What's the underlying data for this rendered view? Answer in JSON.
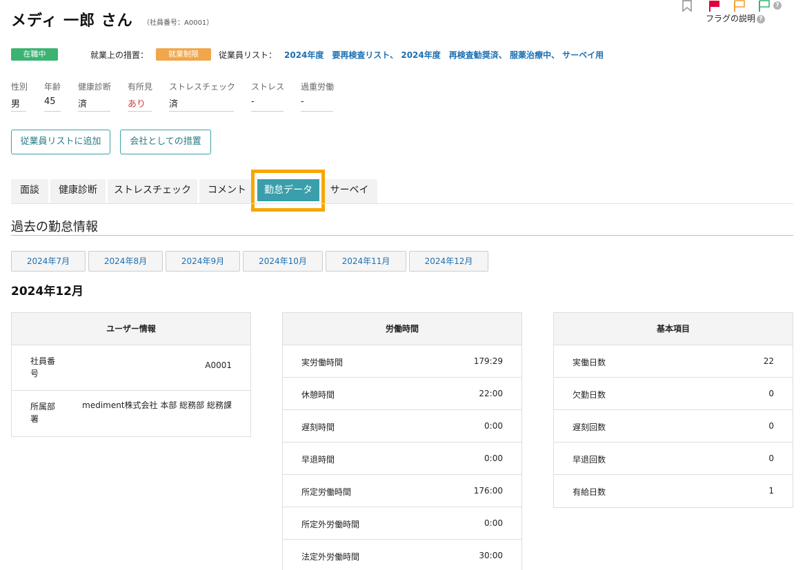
{
  "header": {
    "name": "メディ 一郎 さん",
    "employee_no": "（社員番号：A0001）",
    "flag_explain": "フラグの説明",
    "help_mark": "?"
  },
  "status": {
    "employment": "在職中",
    "measure_label": "就業上の措置：",
    "measure_value": "就業制限",
    "list_label": "従業員リスト：",
    "lists": [
      "2024年度　要再検査リスト、",
      "2024年度　再検査勧奨済、",
      "服薬治療中、",
      "サーベイ用"
    ]
  },
  "attributes": [
    {
      "label": "性別",
      "value": "男"
    },
    {
      "label": "年齢",
      "value": "45"
    },
    {
      "label": "健康診断",
      "value": "済"
    },
    {
      "label": "有所見",
      "value": "あり"
    },
    {
      "label": "ストレスチェック",
      "value": "済"
    },
    {
      "label": "ストレス",
      "value": "-"
    },
    {
      "label": "過重労働",
      "value": "-"
    }
  ],
  "actions": {
    "add_to_list": "従業員リストに追加",
    "company_measure": "会社としての措置"
  },
  "tabs": [
    "面談",
    "健康診断",
    "ストレスチェック",
    "コメント",
    "勤怠データ",
    "サーベイ"
  ],
  "section_title": "過去の勤怠情報",
  "months": [
    "2024年7月",
    "2024年8月",
    "2024年9月",
    "2024年10月",
    "2024年11月",
    "2024年12月"
  ],
  "selected_month": "2024年12月",
  "user_info": {
    "title": "ユーザー情報",
    "employee_no_label": "社員番号",
    "employee_no_value": "A0001",
    "dept_label": "所属部署",
    "dept_value": "mediment株式会社 本部 総務部 総務課"
  },
  "labor_hours": {
    "title": "労働時間",
    "rows": [
      {
        "label": "実労働時間",
        "value": "179:29"
      },
      {
        "label": "休憩時間",
        "value": "22:00"
      },
      {
        "label": "遅刻時間",
        "value": "0:00"
      },
      {
        "label": "早退時間",
        "value": "0:00"
      },
      {
        "label": "所定労働時間",
        "value": "176:00"
      },
      {
        "label": "所定外労働時間",
        "value": "0:00"
      },
      {
        "label": "法定外労働時間",
        "value": "30:00"
      }
    ]
  },
  "basic_items": {
    "title": "基本項目",
    "rows": [
      {
        "label": "実働日数",
        "value": "22"
      },
      {
        "label": "欠勤日数",
        "value": "0"
      },
      {
        "label": "遅刻回数",
        "value": "0"
      },
      {
        "label": "早退回数",
        "value": "0"
      },
      {
        "label": "有給日数",
        "value": "1"
      }
    ]
  },
  "colors": {
    "status_green": "#3cb371",
    "restrict_orange": "#f0a64a",
    "link_blue": "#1a6fb3",
    "tab_active": "#3a9fab",
    "highlight": "#f7a600"
  }
}
